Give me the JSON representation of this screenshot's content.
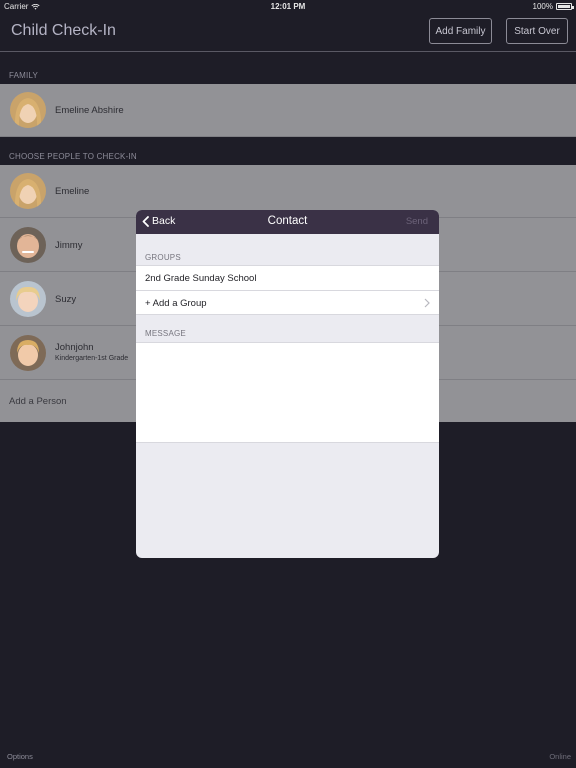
{
  "status_bar": {
    "carrier": "Carrier",
    "time": "12:01 PM",
    "battery": "100%"
  },
  "nav": {
    "title": "Child Check-In",
    "add_family": "Add Family",
    "start_over": "Start Over"
  },
  "family_section": {
    "header": "FAMILY",
    "items": [
      {
        "name": "Emeline Abshire"
      }
    ]
  },
  "checkin_section": {
    "header": "CHOOSE PEOPLE TO CHECK-IN",
    "items": [
      {
        "name": "Emeline",
        "sub": ""
      },
      {
        "name": "Jimmy",
        "sub": ""
      },
      {
        "name": "Suzy",
        "sub": ""
      },
      {
        "name": "Johnjohn",
        "sub": "Kindergarten-1st Grade"
      }
    ],
    "add_person": "Add a Person"
  },
  "footer": {
    "options": "Options",
    "status": "Online"
  },
  "modal": {
    "back": "Back",
    "title": "Contact",
    "send": "Send",
    "groups_header": "GROUPS",
    "groups": [
      "2nd Grade Sunday School"
    ],
    "add_group": "+ Add a Group",
    "message_header": "MESSAGE",
    "message_value": ""
  },
  "colors": {
    "background": "#1e1d27",
    "row": "#929296",
    "modal_header": "#3a3146",
    "modal_body": "#ebebf1"
  }
}
